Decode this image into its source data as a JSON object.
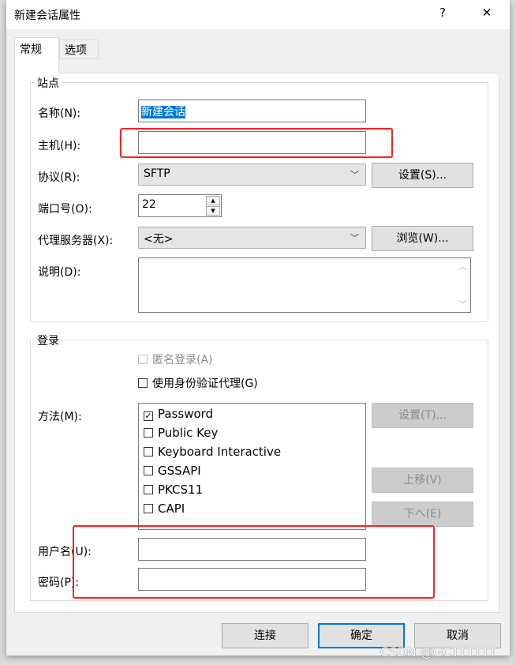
{
  "dialog": {
    "title": "新建会话属性",
    "help": "?",
    "close": "✕"
  },
  "tabs": [
    {
      "label": "常规",
      "active": true
    },
    {
      "label": "选项",
      "active": false
    }
  ],
  "site": {
    "group_label": "站点",
    "name_label": "名称(N):",
    "name_value": "新建会话",
    "host_label": "主机(H):",
    "host_value": "",
    "protocol_label": "协议(R):",
    "protocol_value": "SFTP",
    "protocol_settings": "设置(S)...",
    "port_label": "端口号(O):",
    "port_value": "22",
    "proxy_label": "代理服务器(X):",
    "proxy_value": "<无>",
    "proxy_browse": "浏览(W)...",
    "desc_label": "说明(D):",
    "desc_value": ""
  },
  "login": {
    "group_label": "登录",
    "anonymous": {
      "label": "匿名登录(A)",
      "checked": false,
      "disabled": true
    },
    "agent": {
      "label": "使用身份验证代理(G)",
      "checked": false
    },
    "method_label": "方法(M):",
    "methods": [
      {
        "label": "Password",
        "checked": true
      },
      {
        "label": "Public Key",
        "checked": false
      },
      {
        "label": "Keyboard Interactive",
        "checked": false
      },
      {
        "label": "GSSAPI",
        "checked": false
      },
      {
        "label": "PKCS11",
        "checked": false
      },
      {
        "label": "CAPI",
        "checked": false
      }
    ],
    "settings": "设置(T)...",
    "move_up": "上移(V)",
    "move_down": "下へ(E)",
    "user_label": "用户名(U):",
    "user_value": "",
    "password_label": "密码(P):",
    "password_value": ""
  },
  "footer": {
    "connect": "连接",
    "ok": "确定",
    "cancel": "取消"
  },
  "watermark": "CSDN @GCTTTTTT",
  "colors": {
    "highlight": "#ff1f1f",
    "selection": "#0078d7",
    "default_button": "#0078d7"
  }
}
